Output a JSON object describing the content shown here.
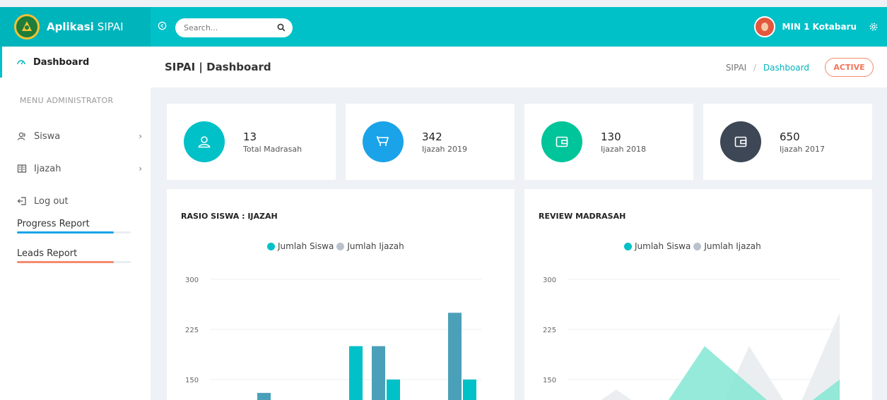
{
  "header": {
    "brand_bold": "Aplikasi",
    "brand_rest": "SIPAI",
    "search_placeholder": "Search...",
    "user_name": "MIN 1 Kotabaru"
  },
  "sidebar": {
    "dashboard_label": "Dashboard",
    "section_label": "MENU ADMINISTRATOR",
    "items": [
      {
        "label": "Siswa"
      },
      {
        "label": "Ijazah"
      },
      {
        "label": "Log out"
      }
    ],
    "reports": [
      {
        "label": "Progress Report",
        "progress": 0.85,
        "color": "#1aa3e8"
      },
      {
        "label": "Leads Report",
        "progress": 0.85,
        "color": "#f58a6e"
      }
    ]
  },
  "content_header": {
    "title": "SIPAI | Dashboard",
    "breadcrumb_root": "SIPAI",
    "breadcrumb_sep": "/",
    "breadcrumb_current": "Dashboard",
    "status_badge": "ACTIVE"
  },
  "stats": [
    {
      "value": "13",
      "label": "Total Madrasah",
      "color": "#00c0c8",
      "icon": "user-icon"
    },
    {
      "value": "342",
      "label": "Ijazah 2019",
      "color": "#1aa3e8",
      "icon": "cart-icon"
    },
    {
      "value": "130",
      "label": "Ijazah 2018",
      "color": "#00c49a",
      "icon": "wallet-icon"
    },
    {
      "value": "650",
      "label": "Ijazah 2017",
      "color": "#3d4756",
      "icon": "wallet-icon"
    }
  ],
  "colors": {
    "accent": "#00c0c8",
    "series_siswa": "#00c0c8",
    "series_ijazah": "#b9c2cc"
  },
  "chart_data": [
    {
      "type": "bar",
      "title": "RASIO SISWA : IJAZAH",
      "ylim": [
        0,
        300
      ],
      "yticks": [
        "300",
        "225",
        "150"
      ],
      "legend": [
        "Jumlah Siswa",
        "Jumlah Ijazah"
      ],
      "series": [
        {
          "name": "Jumlah Siswa",
          "values": [
            null,
            null,
            200,
            150,
            null,
            150
          ]
        },
        {
          "name": "Jumlah Ijazah",
          "values": [
            null,
            130,
            null,
            200,
            null,
            250
          ]
        }
      ]
    },
    {
      "type": "area",
      "title": "REVIEW MADRASAH",
      "ylim": [
        0,
        300
      ],
      "yticks": [
        "300",
        "225",
        "150"
      ],
      "legend": [
        "Jumlah Siswa",
        "Jumlah Ijazah"
      ],
      "series": [
        {
          "name": "Jumlah Siswa",
          "values": [
            0,
            200,
            150
          ]
        },
        {
          "name": "Jumlah Ijazah",
          "values": [
            135,
            200,
            250
          ]
        }
      ]
    }
  ]
}
